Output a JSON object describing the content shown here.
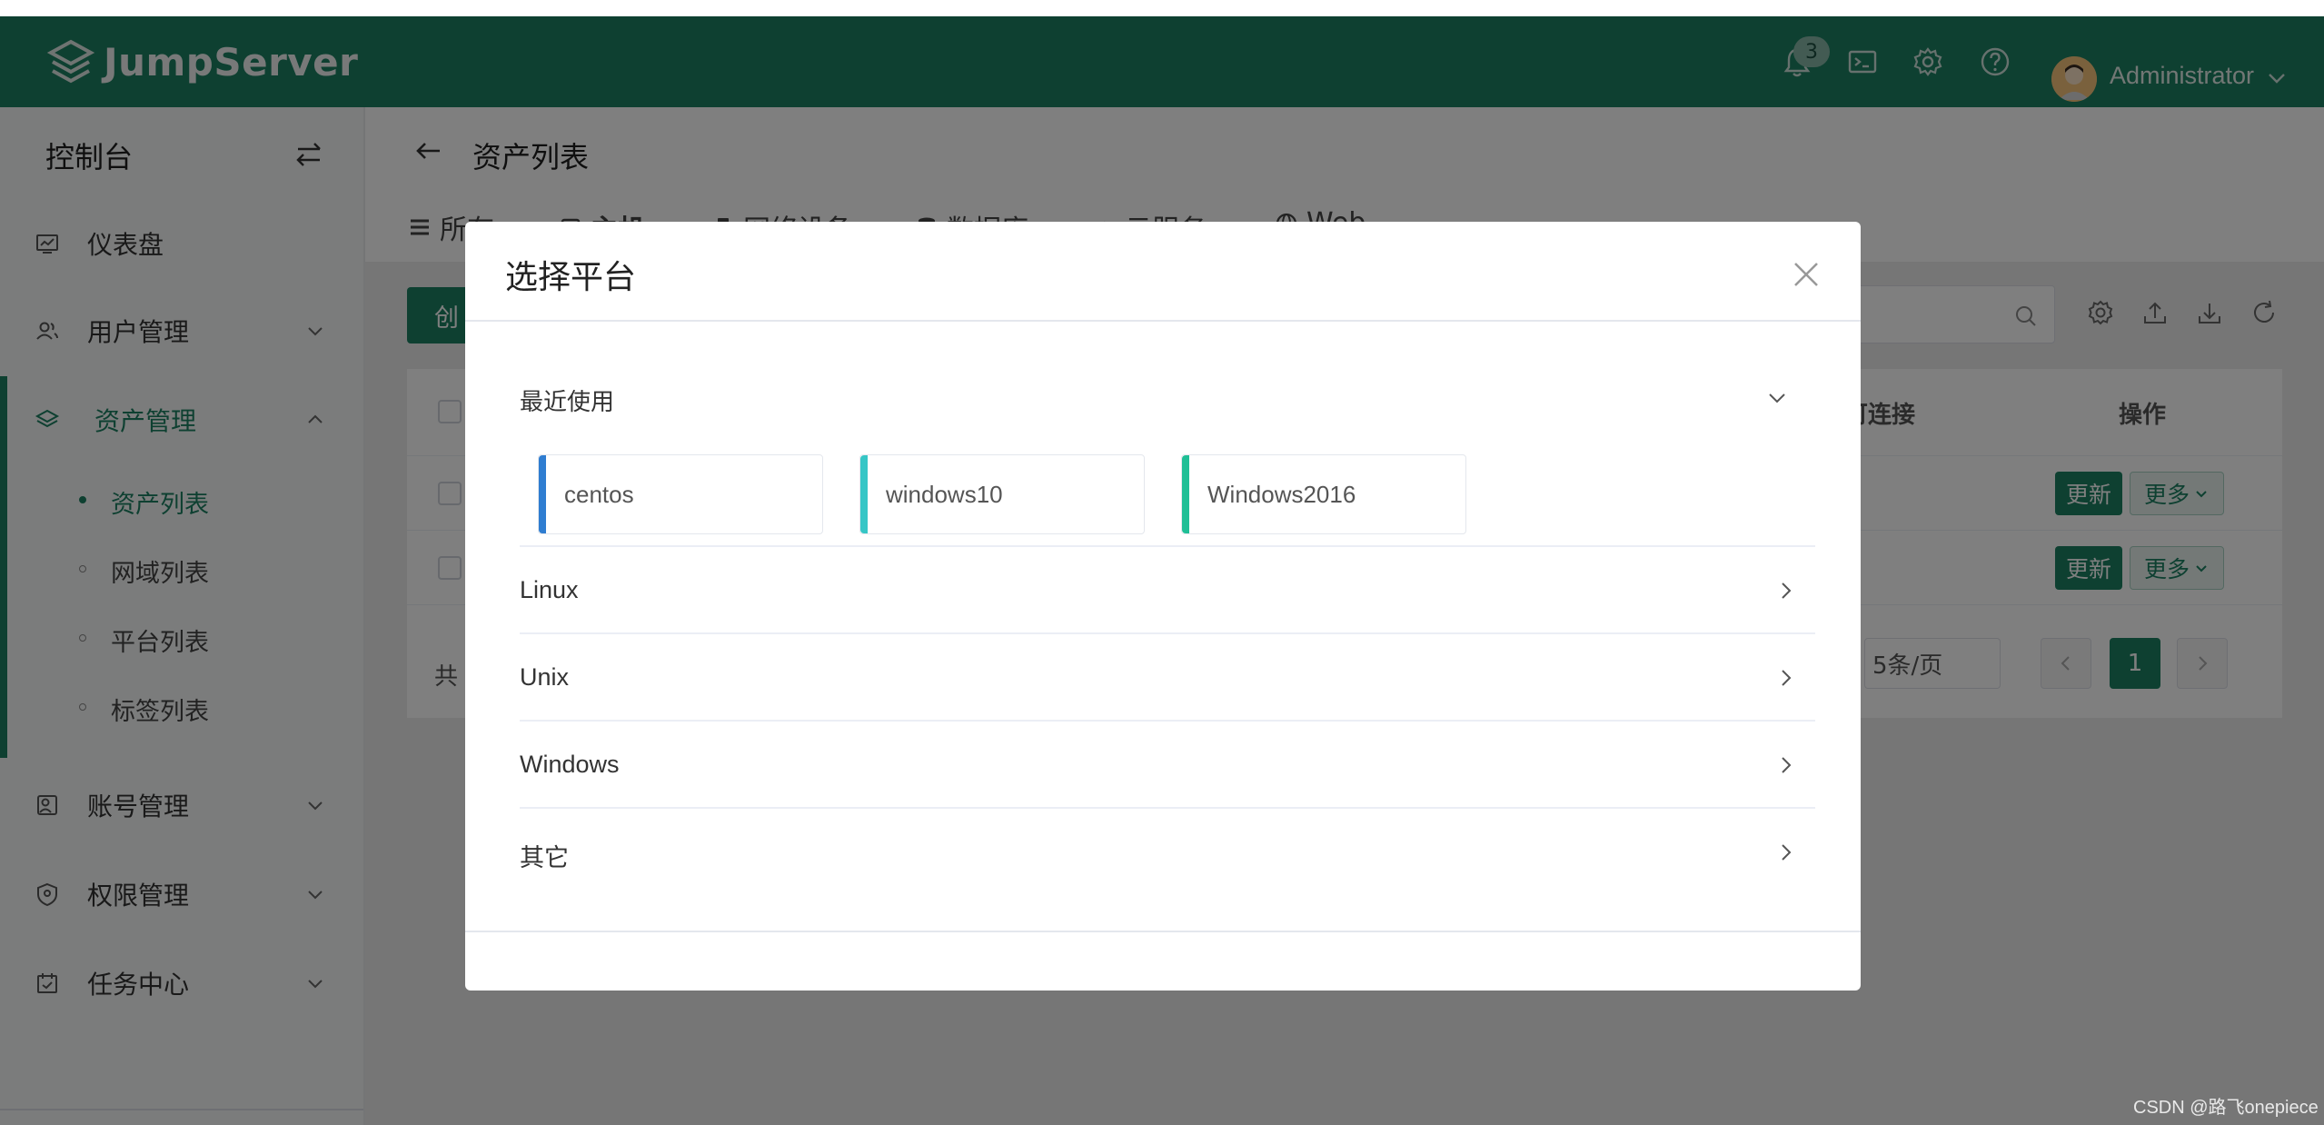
{
  "header": {
    "brand": "JumpServer",
    "notification_count": "3",
    "user_name": "Administrator",
    "icons": [
      "bell-icon",
      "terminal-icon",
      "settings-icon",
      "help-icon"
    ]
  },
  "sidebar": {
    "title": "控制台",
    "items": [
      {
        "label": "仪表盘",
        "icon": "dashboard-icon"
      },
      {
        "label": "用户管理",
        "icon": "users-icon"
      },
      {
        "label": "资产管理",
        "icon": "layers-icon"
      },
      {
        "label": "账号管理",
        "icon": "account-icon"
      },
      {
        "label": "权限管理",
        "icon": "shield-icon"
      },
      {
        "label": "任务中心",
        "icon": "task-icon"
      }
    ],
    "sub_items": [
      {
        "label": "资产列表"
      },
      {
        "label": "网域列表"
      },
      {
        "label": "平台列表"
      },
      {
        "label": "标签列表"
      }
    ],
    "active_color": "#1c8162"
  },
  "main": {
    "page_title": "资产列表",
    "tabs": [
      {
        "label": "所有"
      },
      {
        "label": "主机"
      },
      {
        "label": "网络设备"
      },
      {
        "label": "数据库"
      },
      {
        "label": "云服务"
      },
      {
        "label": "Web"
      }
    ],
    "create_button": "创",
    "table": {
      "columns": [
        "可连接",
        "操作"
      ],
      "rows": [
        {
          "update": "更新",
          "more": "更多"
        },
        {
          "update": "更新",
          "more": "更多"
        }
      ]
    },
    "pager": {
      "total_prefix": "共",
      "page_size": "5条/页",
      "current_page": "1"
    }
  },
  "dialog": {
    "title": "选择平台",
    "recent_label": "最近使用",
    "recent": [
      {
        "name": "centos",
        "color": "#2f7dd1"
      },
      {
        "name": "windows10",
        "color": "#36c6c6"
      },
      {
        "name": "Windows2016",
        "color": "#1fbf96"
      }
    ],
    "categories": [
      {
        "name": "Linux"
      },
      {
        "name": "Unix"
      },
      {
        "name": "Windows"
      },
      {
        "name": "其它"
      }
    ]
  },
  "watermark": "CSDN @路飞onepiece"
}
